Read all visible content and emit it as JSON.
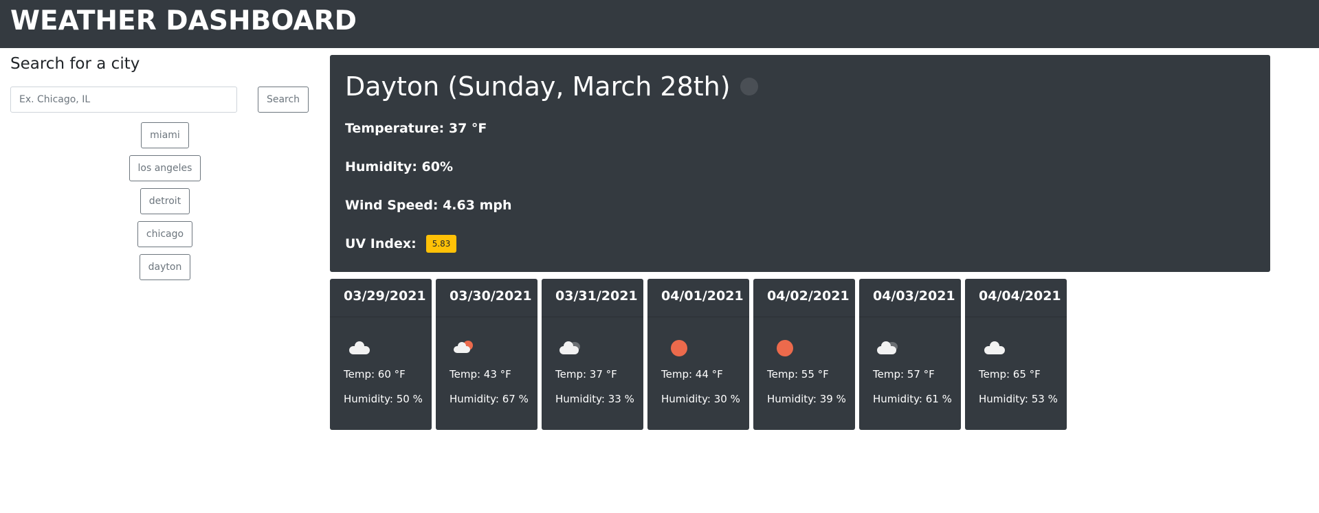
{
  "header": {
    "title": "WEATHER DASHBOARD"
  },
  "search": {
    "heading": "Search for a city",
    "placeholder": "Ex. Chicago, IL",
    "button_label": "Search",
    "history": [
      "miami",
      "los angeles",
      "detroit",
      "chicago",
      "dayton"
    ]
  },
  "current": {
    "city_date": "Dayton (Sunday, March 28th)",
    "temperature": "Temperature: 37 °F",
    "humidity": "Humidity: 60%",
    "wind": "Wind Speed: 4.63 mph",
    "uv_label": "UV Index:",
    "uv_value": "5.83",
    "uv_color": "#ffc107"
  },
  "forecast": [
    {
      "date": "03/29/2021",
      "icon": "cloud-icon",
      "temp": "Temp: 60 °F",
      "humidity": "Humidity: 50 %"
    },
    {
      "date": "03/30/2021",
      "icon": "rain-sun-icon",
      "temp": "Temp: 43 °F",
      "humidity": "Humidity: 67 %"
    },
    {
      "date": "03/31/2021",
      "icon": "cloudy-icon",
      "temp": "Temp: 37 °F",
      "humidity": "Humidity: 33 %"
    },
    {
      "date": "04/01/2021",
      "icon": "sun-icon",
      "temp": "Temp: 44 °F",
      "humidity": "Humidity: 30 %"
    },
    {
      "date": "04/02/2021",
      "icon": "sun-icon",
      "temp": "Temp: 55 °F",
      "humidity": "Humidity: 39 %"
    },
    {
      "date": "04/03/2021",
      "icon": "cloudy-icon",
      "temp": "Temp: 57 °F",
      "humidity": "Humidity: 61 %"
    },
    {
      "date": "04/04/2021",
      "icon": "cloud-icon",
      "temp": "Temp: 65 °F",
      "humidity": "Humidity: 53 %"
    }
  ],
  "colors": {
    "panel": "#343a40",
    "accent_sun": "#ec6a4c",
    "uv_badge": "#ffc107"
  }
}
